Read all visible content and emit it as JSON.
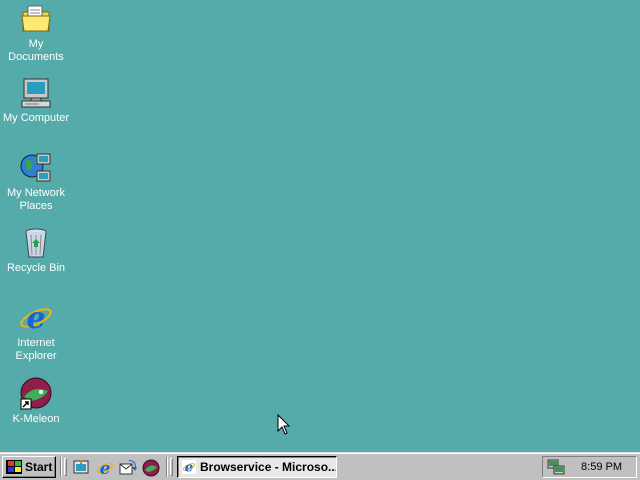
{
  "desktop": {
    "background": "#55AAAA",
    "icons": [
      {
        "label": "My Documents",
        "icon": "folder-documents-icon"
      },
      {
        "label": "My Computer",
        "icon": "computer-icon"
      },
      {
        "label": "My Network Places",
        "icon": "network-places-icon"
      },
      {
        "label": "Recycle Bin",
        "icon": "recycle-bin-icon"
      },
      {
        "label": "Internet Explorer",
        "icon": "internet-explorer-icon"
      },
      {
        "label": "K-Meleon",
        "icon": "k-meleon-icon"
      }
    ]
  },
  "taskbar": {
    "start_label": "Start",
    "quick_launch": [
      "show-desktop-icon",
      "internet-explorer-icon",
      "outlook-express-icon",
      "k-meleon-icon"
    ],
    "active_task": {
      "label": "Browservice - Microso...",
      "icon": "internet-explorer-icon"
    },
    "tray": {
      "clock": "8:59 PM",
      "icon": "network-status-icon"
    }
  }
}
